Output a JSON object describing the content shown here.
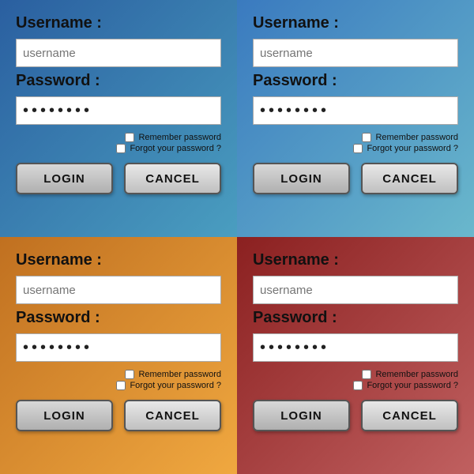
{
  "panels": [
    {
      "id": "panel-1",
      "theme": "panel-1",
      "username_label": "Username :",
      "username_placeholder": "username",
      "password_label": "Password :",
      "password_dots": "••••••••",
      "remember_label": "Remember password",
      "forgot_label": "Forgot your password ?",
      "login_label": "LOGIN",
      "cancel_label": "CANCEL"
    },
    {
      "id": "panel-2",
      "theme": "panel-2",
      "username_label": "Username :",
      "username_placeholder": "username",
      "password_label": "Password :",
      "password_dots": "••••••••",
      "remember_label": "Remember password",
      "forgot_label": "Forgot your password ?",
      "login_label": "LOGIN",
      "cancel_label": "CANCEL"
    },
    {
      "id": "panel-3",
      "theme": "panel-3",
      "username_label": "Username :",
      "username_placeholder": "username",
      "password_label": "Password :",
      "password_dots": "••••••••",
      "remember_label": "Remember password",
      "forgot_label": "Forgot your password ?",
      "login_label": "LOGIN",
      "cancel_label": "CANCEL"
    },
    {
      "id": "panel-4",
      "theme": "panel-4",
      "username_label": "Username :",
      "username_placeholder": "username",
      "password_label": "Password :",
      "password_dots": "••••••••",
      "remember_label": "Remember password",
      "forgot_label": "Forgot your password ?",
      "login_label": "LOGIN",
      "cancel_label": "CANCEL"
    }
  ]
}
